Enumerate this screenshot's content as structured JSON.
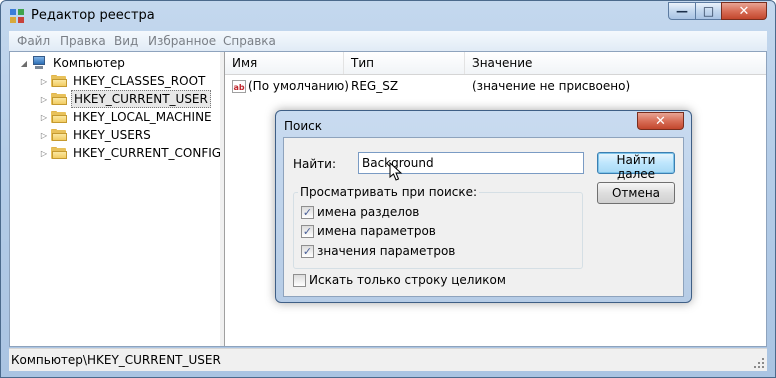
{
  "window": {
    "title": "Редактор реестра",
    "close_glyph": "✕",
    "minimize_glyph": "—",
    "maximize_glyph": "□"
  },
  "menu": [
    "Файл",
    "Правка",
    "Вид",
    "Избранное",
    "Справка"
  ],
  "tree": {
    "root": "Компьютер",
    "items": [
      {
        "label": "HKEY_CLASSES_ROOT"
      },
      {
        "label": "HKEY_CURRENT_USER",
        "selected": true
      },
      {
        "label": "HKEY_LOCAL_MACHINE"
      },
      {
        "label": "HKEY_USERS"
      },
      {
        "label": "HKEY_CURRENT_CONFIG"
      }
    ]
  },
  "list": {
    "columns": [
      "Имя",
      "Тип",
      "Значение"
    ],
    "rows": [
      {
        "name": "(По умолчанию)",
        "type": "REG_SZ",
        "value": "(значение не присвоено)"
      }
    ]
  },
  "status": {
    "path": "Компьютер\\HKEY_CURRENT_USER"
  },
  "dialog": {
    "title": "Поиск",
    "find_label": "Найти:",
    "find_value": "Background",
    "find_next_button": "Найти далее",
    "cancel_button": "Отмена",
    "group_label": "Просматривать при поиске:",
    "options": [
      {
        "label": "имена разделов",
        "checked": true
      },
      {
        "label": "имена параметров",
        "checked": true
      },
      {
        "label": "значения параметров",
        "checked": true
      }
    ],
    "whole_string": {
      "label": "Искать только строку целиком",
      "checked": false
    }
  },
  "icons": {
    "app": "registry-editor-icon",
    "computer": "computer-icon",
    "folder": "folder-icon",
    "string_value": "string-value-icon"
  }
}
